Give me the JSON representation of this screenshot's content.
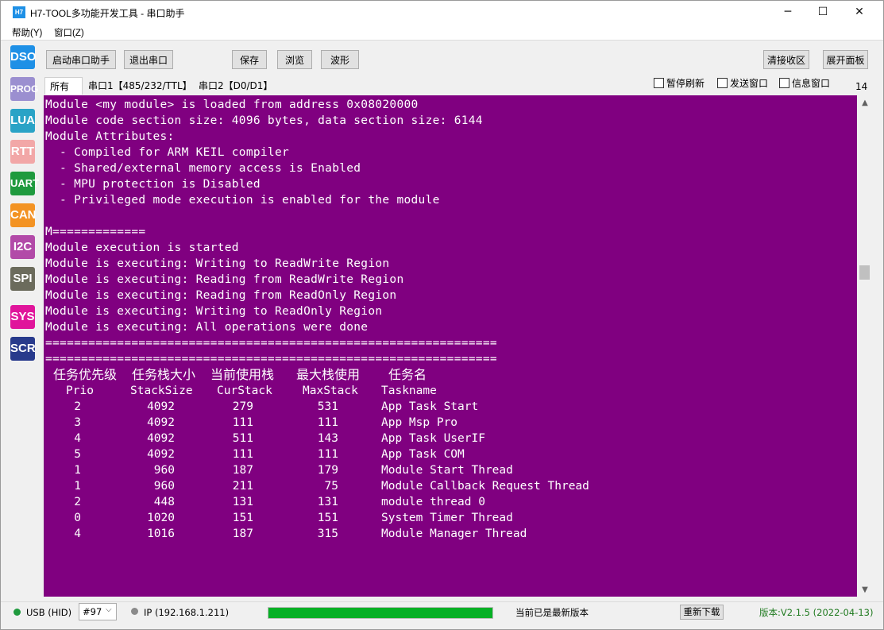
{
  "window": {
    "icon_text": "H7",
    "title": "H7-TOOL多功能开发工具 - 串口助手",
    "minimize_glyph": "─",
    "maximize_glyph": "☐",
    "close_glyph": "✕"
  },
  "menu": [
    "帮助(Y)",
    "窗口(Z)"
  ],
  "side_tools": [
    {
      "label": "DSO",
      "color": "#1e90e6"
    },
    {
      "label": "PROG",
      "color": "#9b8fd0"
    },
    {
      "label": "LUA",
      "color": "#29a3c6"
    },
    {
      "label": "RTT",
      "color": "#f2a7a7"
    },
    {
      "label": "UART",
      "color": "#1f9a3e"
    },
    {
      "label": "CAN",
      "color": "#f39323"
    },
    {
      "label": "I2C",
      "color": "#b24aa8"
    },
    {
      "label": "SPI",
      "color": "#6b6b5c"
    },
    {
      "label": "SYS",
      "color": "#e0159b"
    },
    {
      "label": "SCR",
      "color": "#283a8c"
    }
  ],
  "toolbar": {
    "start": "启动串口助手",
    "exit": "退出串口",
    "save": "保存",
    "browse": "浏览",
    "waveform": "波形",
    "clear_rx": "清接收区",
    "expand_panel": "展开面板"
  },
  "tabs": [
    "所有",
    "串口1【485/232/TTL】",
    "串口2【D0/D1】"
  ],
  "options": {
    "pause_refresh": "暂停刷新",
    "send_window": "发送窗口",
    "info_window": "信息窗口",
    "font_size": "14"
  },
  "terminal": {
    "background": "#800080",
    "lines": [
      "Module <my module> is loaded from address 0x08020000",
      "Module code section size: 4096 bytes, data section size: 6144",
      "Module Attributes:",
      "  - Compiled for ARM KEIL compiler",
      "  - Shared/external memory access is Enabled",
      "  - MPU protection is Disabled",
      "  - Privileged mode execution is enabled for the module",
      "",
      "M=============",
      "Module execution is started",
      "Module is executing: Writing to ReadWrite Region",
      "Module is executing: Reading from ReadWrite Region",
      "Module is executing: Reading from ReadOnly Region",
      "Module is executing: Writing to ReadOnly Region",
      "Module is executing: All operations were done",
      "===============================================================",
      "==============================================================="
    ],
    "task_table": {
      "headers_cn": [
        "任务优先级",
        "任务栈大小",
        "当前使用栈",
        "最大栈使用",
        "任务名"
      ],
      "headers_en": [
        "Prio",
        "StackSize",
        "CurStack",
        "MaxStack",
        "Taskname"
      ],
      "rows": [
        [
          "2",
          "4092",
          "279",
          "531",
          "App Task Start"
        ],
        [
          "3",
          "4092",
          "111",
          "111",
          "App Msp Pro"
        ],
        [
          "4",
          "4092",
          "511",
          "143",
          "App Task UserIF"
        ],
        [
          "5",
          "4092",
          "111",
          "111",
          "App Task COM"
        ],
        [
          "1",
          "960",
          "187",
          "179",
          "Module Start Thread"
        ],
        [
          "1",
          "960",
          "211",
          "75",
          "Module Callback Request Thread"
        ],
        [
          "2",
          "448",
          "131",
          "131",
          "module thread 0"
        ],
        [
          "0",
          "1020",
          "151",
          "151",
          "System Timer Thread"
        ],
        [
          "4",
          "1016",
          "187",
          "315",
          "Module Manager Thread"
        ]
      ]
    }
  },
  "status": {
    "usb": "USB (HID)",
    "device": "#97",
    "ip": "IP (192.168.1.211)",
    "progress": 1.0,
    "progress_color": "#06b025",
    "message": "当前已是最新版本",
    "redownload": "重新下载",
    "version": "版本:V2.1.5 (2022-04-13)",
    "usb_dot_color": "#1f9a3e",
    "ip_dot_color": "#8a8a8a",
    "version_color": "#1f7a1f"
  }
}
